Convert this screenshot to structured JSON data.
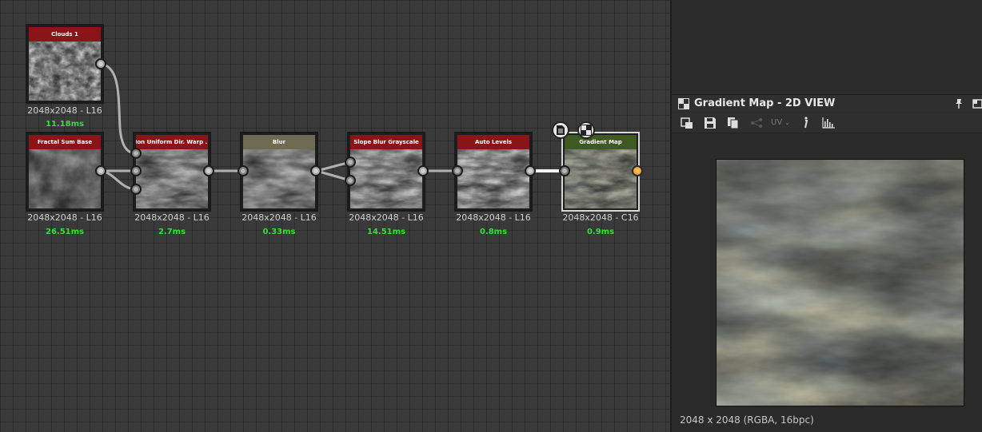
{
  "graph": {
    "nodes": [
      {
        "id": "clouds",
        "title": "Clouds 1",
        "resolution": "2048x2048 - L16",
        "time": "11.18ms"
      },
      {
        "id": "fractal",
        "title": "Fractal Sum Base",
        "resolution": "2048x2048 - L16",
        "time": "26.51ms"
      },
      {
        "id": "warp",
        "title": "Non Uniform Dir. Warp ...",
        "resolution": "2048x2048 - L16",
        "time": "2.7ms"
      },
      {
        "id": "blur",
        "title": "Blur",
        "resolution": "2048x2048 - L16",
        "time": "0.33ms"
      },
      {
        "id": "slopeblur",
        "title": "Slope Blur Grayscale",
        "resolution": "2048x2048 - L16",
        "time": "14.51ms"
      },
      {
        "id": "autolevels",
        "title": "Auto Levels",
        "resolution": "2048x2048 - L16",
        "time": "0.8ms"
      },
      {
        "id": "gradientmap",
        "title": "Gradient Map",
        "resolution": "2048x2048 - C16",
        "time": "0.9ms"
      }
    ],
    "floating_icons": [
      "document-icon",
      "checker-icon"
    ]
  },
  "panel": {
    "title": "Gradient Map - 2D VIEW",
    "uv_label": "UV",
    "toolbar_icons": [
      "viewport-fit-icon",
      "save-icon",
      "copy-icon",
      "share-icon",
      "uv-icon",
      "info-icon",
      "histogram-icon"
    ],
    "status": "2048 x 2048 (RGBA, 16bpc)"
  },
  "colors": {
    "header_red": "#8a1519",
    "header_olive": "#6e6b52",
    "header_green": "#3e5a22",
    "time_green": "#34e034",
    "output_orange": "#f0a53a"
  }
}
